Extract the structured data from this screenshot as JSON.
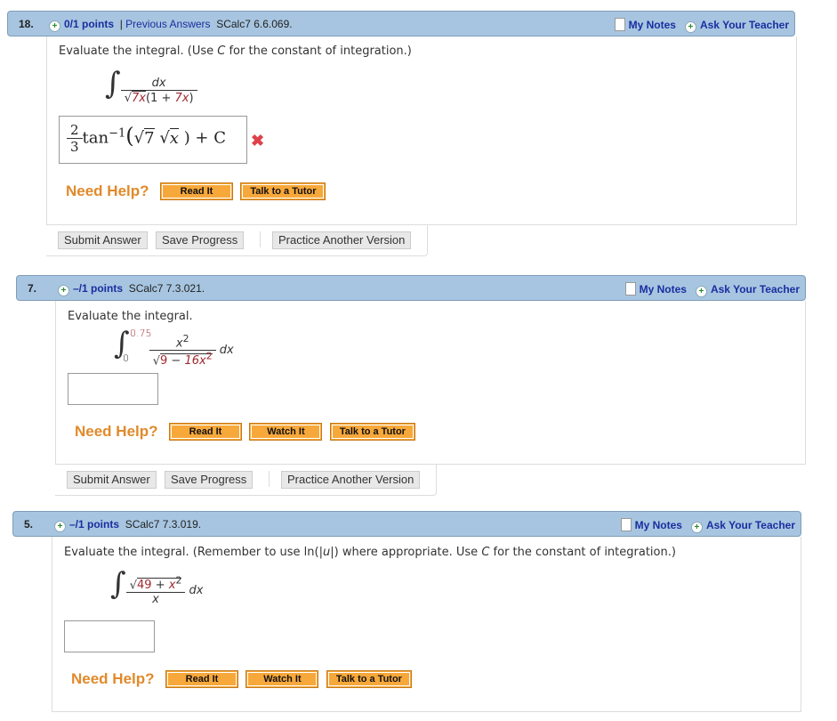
{
  "questions": [
    {
      "number": "18.",
      "points": "0/1 points",
      "separator": "|",
      "previous_answers": "Previous Answers",
      "code": "SCalc7 6.6.069.",
      "my_notes": "My Notes",
      "ask_teacher": "Ask Your Teacher",
      "prompt_a": "Evaluate the integral. (Use ",
      "prompt_c": "C",
      "prompt_b": " for the constant of integration.)",
      "integrand_num": "dx",
      "integrand_den_a": "7x",
      "integrand_den_b": "(1 + ",
      "integrand_den_c": "7x",
      "integrand_den_d": ")",
      "answer": {
        "num": "2",
        "den": "3",
        "body": "tan",
        "sup": "−1",
        "arg_a": "7",
        "arg_b": "x",
        "tail": ") + C",
        "status": "incorrect"
      },
      "need_help": "Need Help?",
      "help_buttons": [
        "Read It",
        "Talk to a Tutor"
      ],
      "actions": [
        "Submit Answer",
        "Save Progress",
        "Practice Another Version"
      ]
    },
    {
      "number": "7.",
      "points": "–/1 points",
      "code": "SCalc7 7.3.021.",
      "my_notes": "My Notes",
      "ask_teacher": "Ask Your Teacher",
      "prompt": "Evaluate the integral.",
      "upper": "0.75",
      "lower": "0",
      "num": "x",
      "num_sup": "2",
      "den_a": "9",
      "den_b": " − ",
      "den_c": "16x",
      "den_sup": "2",
      "dx": "dx",
      "answer": "",
      "need_help": "Need Help?",
      "help_buttons": [
        "Read It",
        "Watch It",
        "Talk to a Tutor"
      ],
      "actions": [
        "Submit Answer",
        "Save Progress",
        "Practice Another Version"
      ]
    },
    {
      "number": "5.",
      "points": "–/1 points",
      "code": "SCalc7 7.3.019.",
      "my_notes": "My Notes",
      "ask_teacher": "Ask Your Teacher",
      "prompt_a": "Evaluate the integral. (Remember to use ln(|",
      "prompt_u": "u",
      "prompt_b": "|) where appropriate. Use ",
      "prompt_c": "C",
      "prompt_d": " for the constant of integration.)",
      "num_a": "49",
      "num_b": " + ",
      "num_c": "x",
      "num_sup": "2",
      "den": "x",
      "dx": "dx",
      "answer": "",
      "need_help": "Need Help?",
      "help_buttons": [
        "Read It",
        "Watch It",
        "Talk to a Tutor"
      ]
    }
  ],
  "colors": {
    "header_bg": "#a7c5e0",
    "link": "#1a2ea0",
    "help_orange": "#e08a2a",
    "button_orange": "#f7a83a",
    "incorrect": "#e0404a"
  }
}
